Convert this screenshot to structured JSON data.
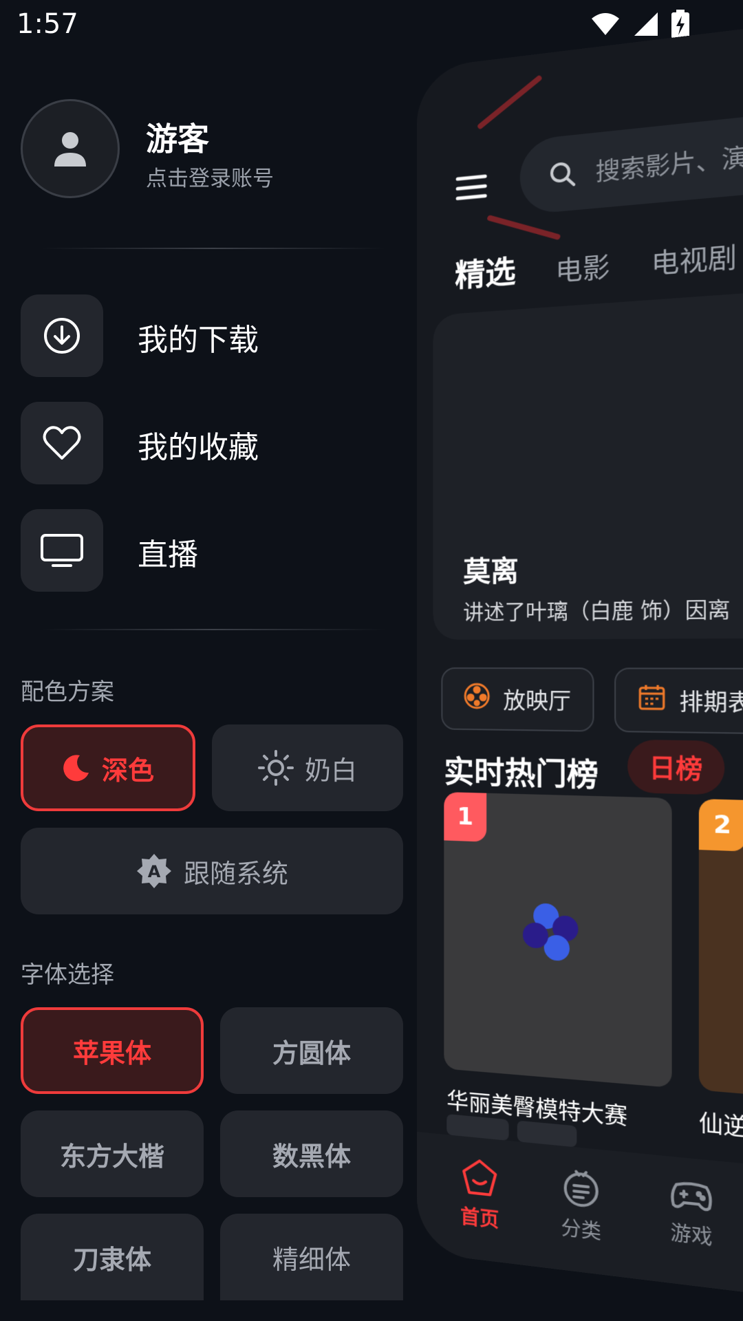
{
  "status": {
    "time": "1:57"
  },
  "profile": {
    "name": "游客",
    "subtitle": "点击登录账号"
  },
  "menu": [
    {
      "label": "我的下载",
      "icon": "download-icon"
    },
    {
      "label": "我的收藏",
      "icon": "heart-icon"
    },
    {
      "label": "直播",
      "icon": "tv-icon"
    }
  ],
  "theme": {
    "section_label": "配色方案",
    "options": {
      "dark": "深色",
      "light": "奶白",
      "system": "跟随系统"
    },
    "selected": "dark"
  },
  "fonts": {
    "section_label": "字体选择",
    "options": [
      "苹果体",
      "方圆体",
      "东方大楷",
      "数黑体",
      "刀隶体",
      "精细体"
    ],
    "selected": "苹果体"
  },
  "preview": {
    "search_placeholder": "搜索影片、演",
    "tabs": [
      "精选",
      "电影",
      "电视剧"
    ],
    "banner": {
      "title": "莫离",
      "desc": "讲述了叶璃（白鹿 饰）因离"
    },
    "chips": [
      "放映厅",
      "排期表"
    ],
    "hot": {
      "title": "实时热门榜",
      "pill": "日榜"
    },
    "posters": [
      {
        "rank": "1",
        "title": "华丽美臀模特大赛"
      },
      {
        "rank": "2",
        "title": "仙逆"
      }
    ],
    "nav": [
      "首页",
      "分类",
      "游戏"
    ]
  },
  "colors": {
    "accent": "#ef3b3b",
    "rank1": "#ff5a5f",
    "rank2": "#f5962e",
    "chip_icon": "#f07a2a"
  }
}
